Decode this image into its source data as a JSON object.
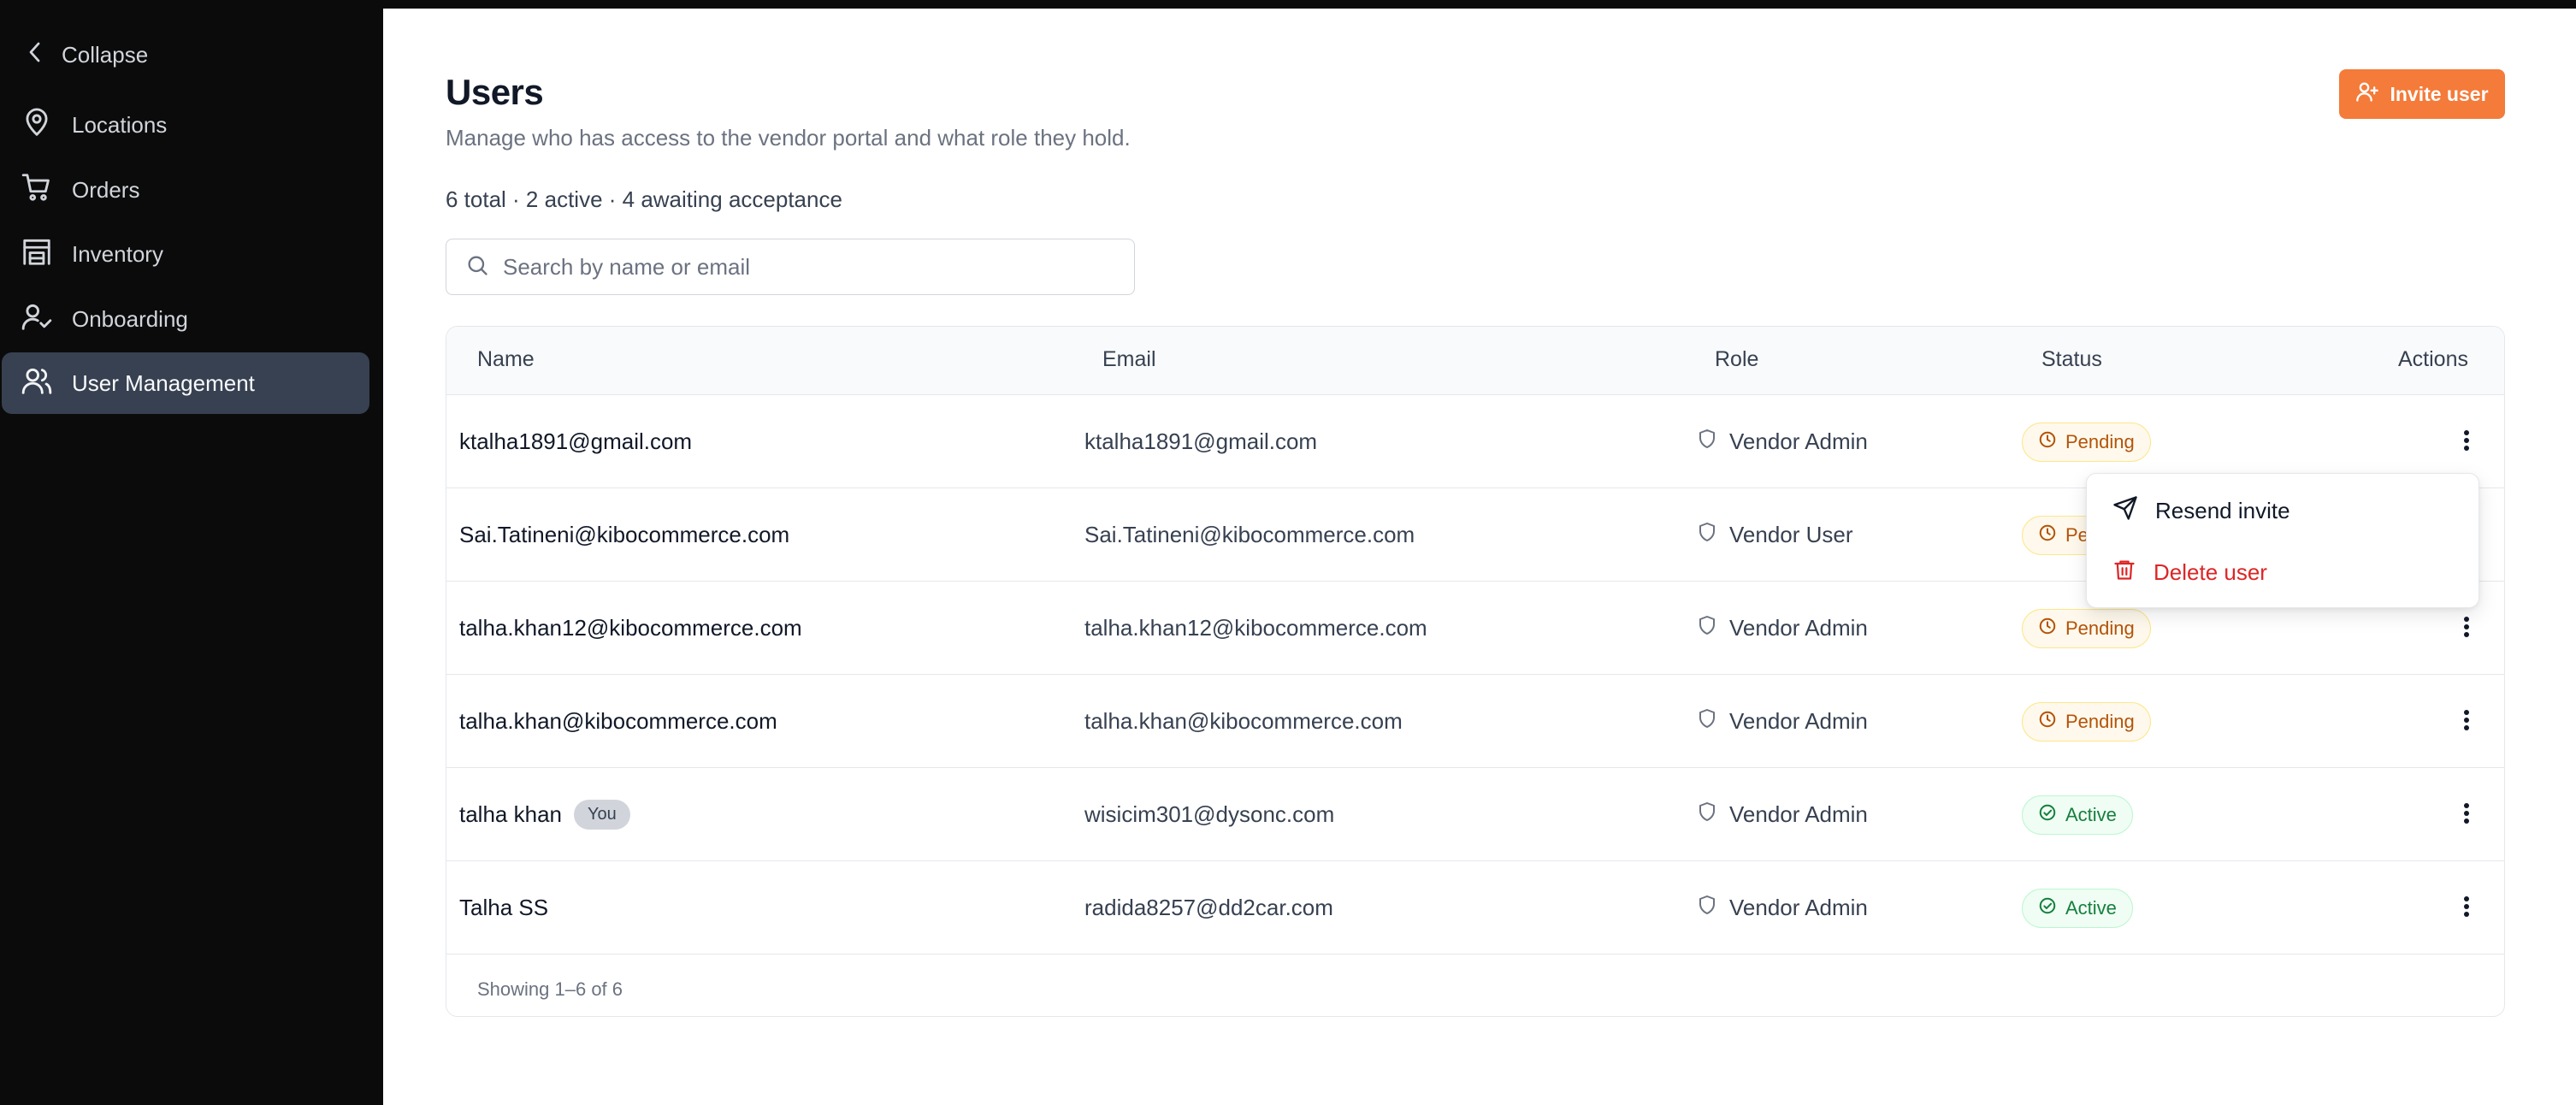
{
  "sidebar": {
    "collapse_label": "Collapse",
    "items": [
      {
        "label": "Locations",
        "icon": "map-pin-icon"
      },
      {
        "label": "Orders",
        "icon": "shopping-cart-icon"
      },
      {
        "label": "Inventory",
        "icon": "warehouse-icon"
      },
      {
        "label": "Onboarding",
        "icon": "user-check-icon"
      },
      {
        "label": "User Management",
        "icon": "users-icon",
        "active": true
      }
    ]
  },
  "header": {
    "title": "Users",
    "subtitle": "Manage who has access to the vendor portal and what role they hold.",
    "invite_label": "Invite user"
  },
  "summary": "6 total · 2 active · 4 awaiting acceptance",
  "search": {
    "placeholder": "Search by name or email",
    "value": ""
  },
  "table": {
    "columns": [
      "Name",
      "Email",
      "Role",
      "Status",
      "Actions"
    ],
    "rows": [
      {
        "name": "ktalha1891@gmail.com",
        "email": "ktalha1891@gmail.com",
        "role": "Vendor Admin",
        "status": "Pending"
      },
      {
        "name": "Sai.Tatineni@kibocommerce.com",
        "email": "Sai.Tatineni@kibocommerce.com",
        "role": "Vendor User",
        "status": "Pending"
      },
      {
        "name": "talha.khan12@kibocommerce.com",
        "email": "talha.khan12@kibocommerce.com",
        "role": "Vendor Admin",
        "status": "Pending"
      },
      {
        "name": "talha.khan@kibocommerce.com",
        "email": "talha.khan@kibocommerce.com",
        "role": "Vendor Admin",
        "status": "Pending"
      },
      {
        "name": "talha khan",
        "badge": "You",
        "email": "wisicim301@dysonc.com",
        "role": "Vendor Admin",
        "status": "Active"
      },
      {
        "name": "Talha SS",
        "email": "radida8257@dd2car.com",
        "role": "Vendor Admin",
        "status": "Active"
      }
    ],
    "footer": "Showing 1–6 of 6"
  },
  "row_menu": {
    "resend_label": "Resend invite",
    "delete_label": "Delete user"
  },
  "colors": {
    "accent": "#f47b3a",
    "sidebar_bg": "#0b0b0b",
    "sidebar_active": "#374151",
    "pending": "#b45309",
    "active": "#15803d",
    "danger": "#dc2626"
  }
}
